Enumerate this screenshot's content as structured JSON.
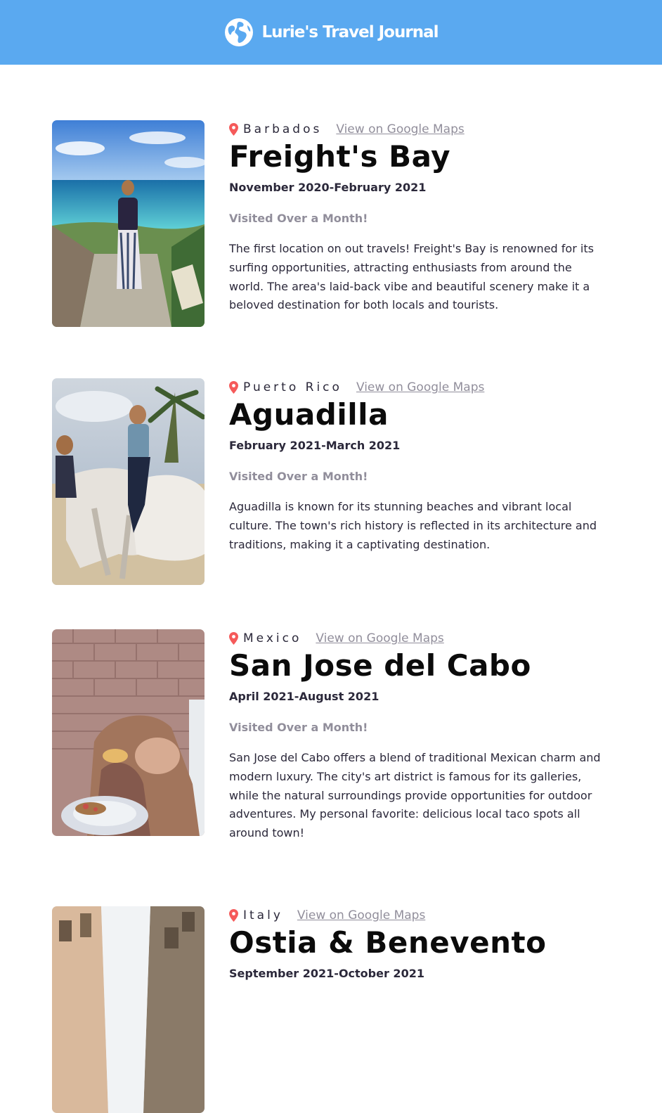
{
  "header": {
    "title": "Lurie's Travel Journal",
    "icon": "globe-icon",
    "background": "#5aa9f0"
  },
  "entries": [
    {
      "country": "Barbados",
      "maps_link": "View on Google Maps",
      "title": "Freight's Bay",
      "dates": "November 2020-February 2021",
      "visited": "Visited Over a Month!",
      "description": "The first location on out travels! Freight's Bay is renowned for its surfing opportunities, attracting enthusiasts from around the world. The area's laid-back vibe and beautiful scenery make it a beloved destination for both locals and tourists."
    },
    {
      "country": "Puerto Rico",
      "maps_link": "View on Google Maps",
      "title": "Aguadilla",
      "dates": "February 2021-March 2021",
      "visited": "Visited Over a Month!",
      "description": "Aguadilla is known for its stunning beaches and vibrant local culture. The town's rich history is reflected in its architecture and traditions, making it a captivating destination."
    },
    {
      "country": "Mexico",
      "maps_link": "View on Google Maps",
      "title": "San Jose del Cabo",
      "dates": "April 2021-August 2021",
      "visited": "Visited Over a Month!",
      "description": "San Jose del Cabo offers a blend of traditional Mexican charm and modern luxury. The city's art district is famous for its galleries, while the natural surroundings provide opportunities for outdoor adventures. My personal favorite: delicious local taco spots all around town!"
    },
    {
      "country": "Italy",
      "maps_link": "View on Google Maps",
      "title": "Ostia & Benevento",
      "dates": "September 2021-October 2021"
    }
  ],
  "colors": {
    "pin": "#f55a5a",
    "link": "#918e9b",
    "text": "#2b283a"
  }
}
